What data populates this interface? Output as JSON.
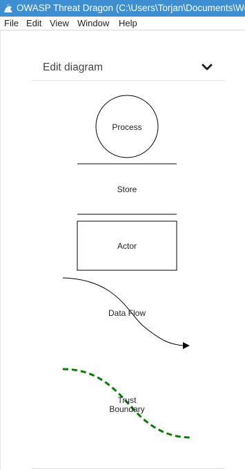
{
  "window": {
    "title": "OWASP Threat Dragon (C:\\Users\\Torjan\\Documents\\Web",
    "accent": "#3d8fd1"
  },
  "menu": {
    "items": [
      {
        "label": "File"
      },
      {
        "label": "Edit"
      },
      {
        "label": "View"
      },
      {
        "label": "Window"
      },
      {
        "label": "Help"
      }
    ]
  },
  "panel": {
    "title": "Edit diagram",
    "toggle_icon": "chevron-down-icon"
  },
  "stencils": {
    "process": {
      "label": "Process"
    },
    "store": {
      "label": "Store"
    },
    "actor": {
      "label": "Actor"
    },
    "data_flow": {
      "label": "Data Flow"
    },
    "trust_boundary": {
      "line1": "Trust",
      "line2": "Boundary",
      "color": "#008000"
    }
  }
}
